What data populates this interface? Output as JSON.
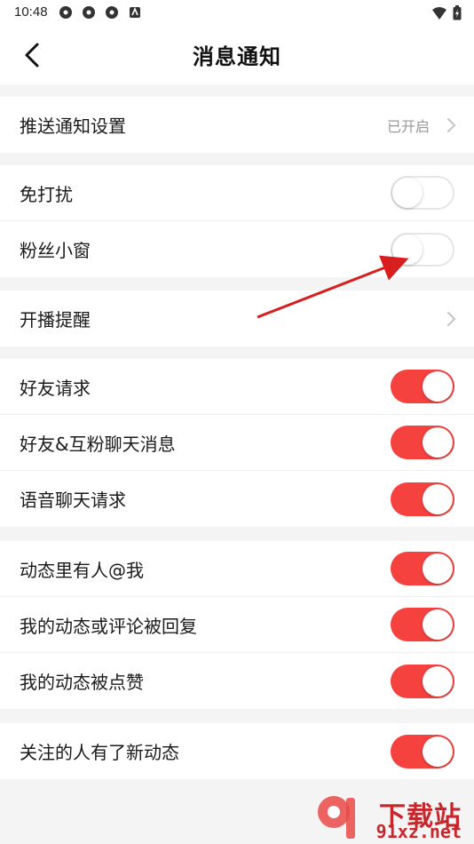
{
  "status_bar": {
    "time": "10:48"
  },
  "header": {
    "title": "消息通知"
  },
  "push": {
    "label": "推送通知设置",
    "status": "已开启"
  },
  "group1": [
    {
      "label": "免打扰",
      "on": false
    },
    {
      "label": "粉丝小窗",
      "on": false
    }
  ],
  "live": {
    "label": "开播提醒"
  },
  "group2": [
    {
      "label": "好友请求",
      "on": true
    },
    {
      "label": "好友&互粉聊天消息",
      "on": true
    },
    {
      "label": "语音聊天请求",
      "on": true
    }
  ],
  "group3": [
    {
      "label": "动态里有人@我",
      "on": true
    },
    {
      "label": "我的动态或评论被回复",
      "on": true
    },
    {
      "label": "我的动态被点赞",
      "on": true
    }
  ],
  "group4": [
    {
      "label": "关注的人有了新动态",
      "on": true
    }
  ],
  "watermark": {
    "text": "下载站",
    "domain": "91xz.net"
  },
  "colors": {
    "toggle_on": "#f5423f",
    "annotation_arrow": "#d81e1e"
  }
}
